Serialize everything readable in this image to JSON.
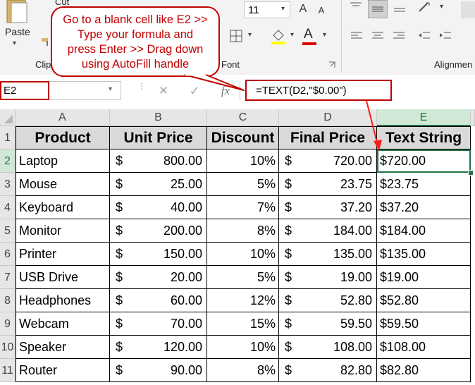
{
  "ribbon": {
    "paste_label": "Paste",
    "cut_label": "Cut",
    "clipboard_label": "Clip",
    "font_size": "11",
    "font_group_label": "Font",
    "alignment_group_label": "Alignmen",
    "grow_font_glyph": "A",
    "shrink_font_glyph": "A",
    "font_color_glyph": "A",
    "font_color_hex": "#e00000"
  },
  "callout": {
    "lines": [
      "Go to a blank cell like E2 >>",
      "Type your formula and",
      "press Enter >> Drag down",
      "using AutoFill handle"
    ]
  },
  "formula_bar": {
    "name_box": "E2",
    "cancel_glyph": "✕",
    "enter_glyph": "✓",
    "fx_glyph": "fx",
    "formula": "=TEXT(D2,\"$0.00\")"
  },
  "sheet": {
    "columns": [
      "A",
      "B",
      "C",
      "D",
      "E"
    ],
    "rows": [
      "1",
      "2",
      "3",
      "4",
      "5",
      "6",
      "7",
      "8",
      "9",
      "10",
      "11"
    ],
    "headers": [
      "Product",
      "Unit Price",
      "Discount",
      "Final Price",
      "Text String"
    ],
    "currency_symbol": "$",
    "data": [
      {
        "product": "Laptop",
        "unit_price": "800.00",
        "discount": "10%",
        "final_price": "720.00",
        "text_string": "$720.00"
      },
      {
        "product": "Mouse",
        "unit_price": "25.00",
        "discount": "5%",
        "final_price": "23.75",
        "text_string": "$23.75"
      },
      {
        "product": "Keyboard",
        "unit_price": "40.00",
        "discount": "7%",
        "final_price": "37.20",
        "text_string": "$37.20"
      },
      {
        "product": "Monitor",
        "unit_price": "200.00",
        "discount": "8%",
        "final_price": "184.00",
        "text_string": "$184.00"
      },
      {
        "product": "Printer",
        "unit_price": "150.00",
        "discount": "10%",
        "final_price": "135.00",
        "text_string": "$135.00"
      },
      {
        "product": "USB Drive",
        "unit_price": "20.00",
        "discount": "5%",
        "final_price": "19.00",
        "text_string": "$19.00"
      },
      {
        "product": "Headphones",
        "unit_price": "60.00",
        "discount": "12%",
        "final_price": "52.80",
        "text_string": "$52.80"
      },
      {
        "product": "Webcam",
        "unit_price": "70.00",
        "discount": "15%",
        "final_price": "59.50",
        "text_string": "$59.50"
      },
      {
        "product": "Speaker",
        "unit_price": "120.00",
        "discount": "10%",
        "final_price": "108.00",
        "text_string": "$108.00"
      },
      {
        "product": "Router",
        "unit_price": "90.00",
        "discount": "8%",
        "final_price": "82.80",
        "text_string": "$82.80"
      }
    ],
    "selected_cell": "E2",
    "header_fill": "#d9d9d9",
    "selection_color": "#217346",
    "annotation_color": "#c00000"
  }
}
